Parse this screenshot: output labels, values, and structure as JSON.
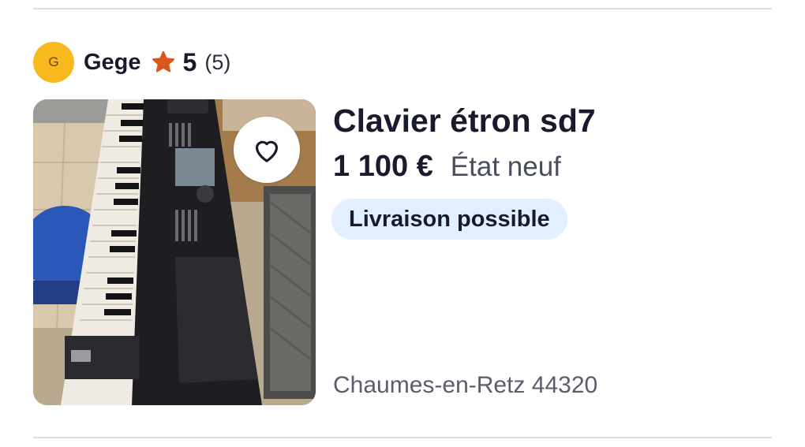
{
  "divider_count": 2,
  "seller": {
    "avatar_initial": "G",
    "name": "Gege",
    "star_icon": "star-icon",
    "rating": "5",
    "review_count": "(5)",
    "avatar_color": "#f8b91f",
    "star_color": "#d9561c"
  },
  "listing": {
    "image_alt": "Clavier étron sd7",
    "favorite_icon": "heart-outline-icon",
    "title": "Clavier étron sd7",
    "price": "1 100 €",
    "condition": "État neuf",
    "delivery_badge": "Livraison possible",
    "location": "Chaumes-en-Retz 44320",
    "badge_color": "#e2efff"
  }
}
